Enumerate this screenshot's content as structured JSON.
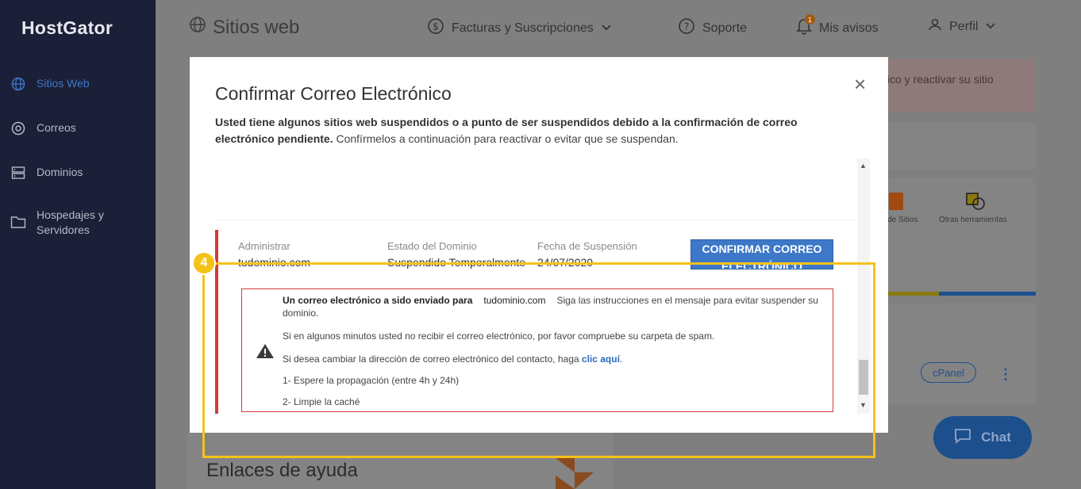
{
  "app": {
    "logo": "HostGator"
  },
  "sidebar": {
    "items": [
      {
        "label": "Sitios Web",
        "icon": "globe-icon",
        "active": true
      },
      {
        "label": "Correos",
        "icon": "at-icon"
      },
      {
        "label": "Dominios",
        "icon": "server-icon"
      },
      {
        "label": "Hospedajes y Servidores",
        "icon": "folder-icon"
      }
    ]
  },
  "topbar": {
    "title": "Sitios web",
    "billing": "Facturas y Suscripciones",
    "support": "Soporte",
    "notices": "Mis avisos",
    "notices_count": "1",
    "profile": "Perfil"
  },
  "background": {
    "alert_text": "nico y reactivar su sitio",
    "tool_1": "r de Sitios",
    "tool_2": "Otras herramientas",
    "cpanel": "cPanel",
    "chat": "Chat",
    "help_title": "Enlaces de ayuda"
  },
  "modal": {
    "title": "Confirmar Correo Electrónico",
    "close": "×",
    "desc_bold": "Usted tiene algunos sitios web suspendidos o a punto de ser suspendidos debido a la confirmación de correo electrónico pendiente.",
    "desc_rest": " Confírmelos a continuación para reactivar o evitar que se suspendan.",
    "card": {
      "col1_label": "Administrar",
      "col1_value": "tudominio.com",
      "col2_label": "Estado del Dominio",
      "col2_value": "Suspendido Temporalmente",
      "col3_label": "Fecha de Suspensión",
      "col3_value": "24/07/2020",
      "confirm_button": "CONFIRMAR CORREO ELECTRÓNICO"
    },
    "warning": {
      "sent_bold": "Un correo electrónico a sido enviado para",
      "email": "tudominio.com",
      "sent_rest": "Siga las instrucciones en el mensaje para evitar suspender su dominio.",
      "spam": "Si en algunos minutos usted no recibir el correo electrónico, por favor compruebe su carpeta de spam.",
      "change_text": "Si desea cambiar la dirección de correo electrónico del contacto, haga",
      "change_link": "clic aquí",
      "change_end": ".",
      "step1": "1- Espere la propagación (entre 4h y 24h)",
      "step2": "2- Limpie la caché"
    }
  },
  "annotation": {
    "badge": "4"
  },
  "colors": {
    "sidebar_bg": "#1b1f37",
    "accent": "#3e78c8",
    "danger": "#d23a3a",
    "annotation": "#f5c21a"
  }
}
